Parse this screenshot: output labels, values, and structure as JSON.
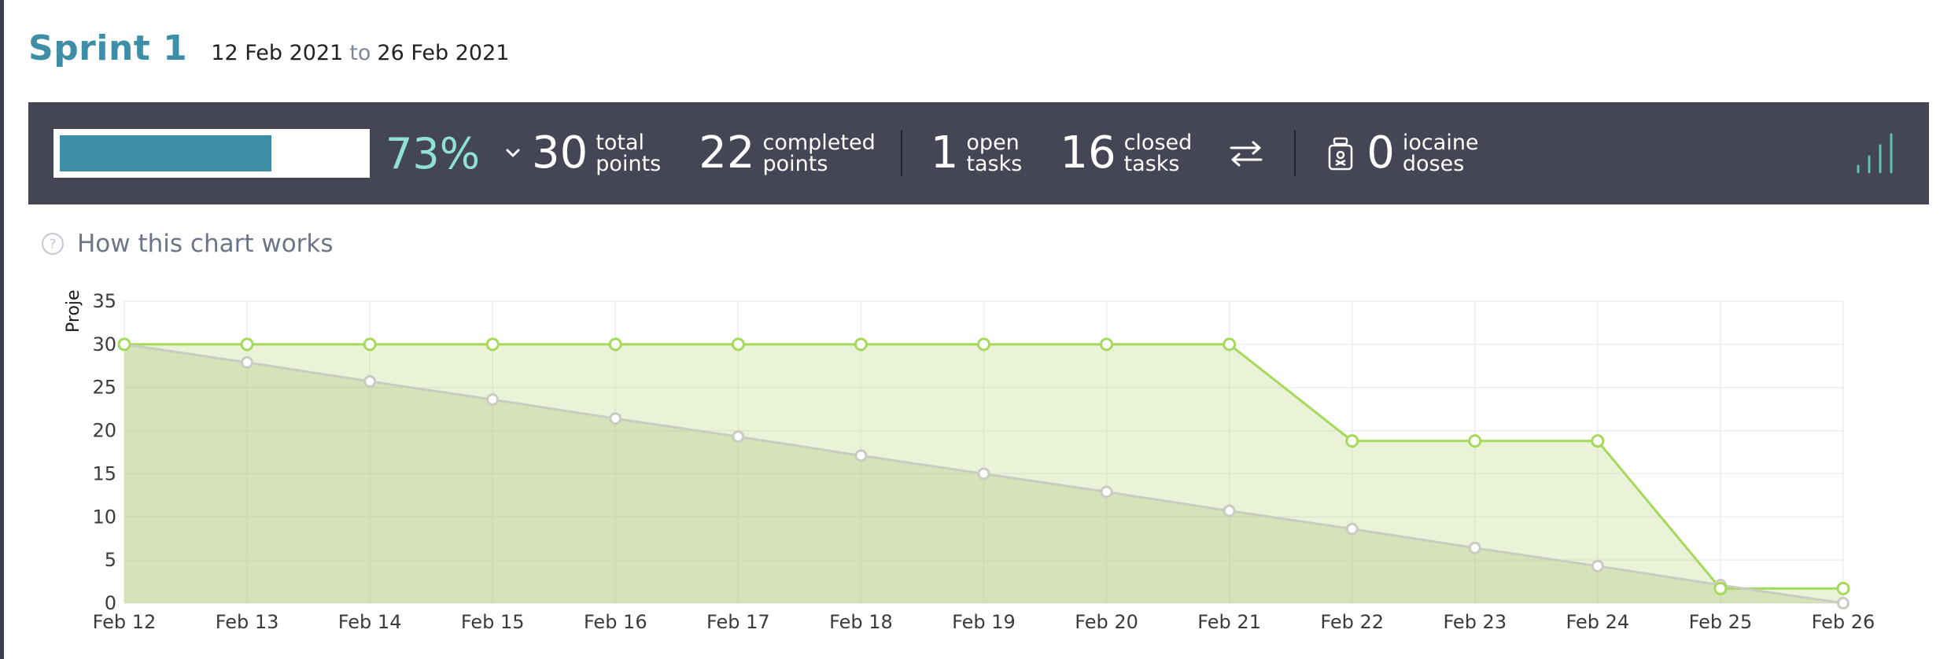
{
  "sprint": {
    "title": "Sprint 1",
    "start_date": "12 Feb 2021",
    "to": "to",
    "end_date": "26 Feb 2021"
  },
  "stats": {
    "progress_percent": 73,
    "progress_label": "73%",
    "total_points": "30",
    "total_label_1": "total",
    "total_label_2": "points",
    "completed_points": "22",
    "completed_label_1": "completed",
    "completed_label_2": "points",
    "open_tasks": "1",
    "open_label_1": "open",
    "open_label_2": "tasks",
    "closed_tasks": "16",
    "closed_label_1": "closed",
    "closed_label_2": "tasks",
    "iocaine_doses": "0",
    "iocaine_label_1": "iocaine",
    "iocaine_label_2": "doses"
  },
  "icons": {
    "expand": "chevron-down-icon",
    "swap": "swap-arrows-icon",
    "iocaine": "poison-jar-icon",
    "chart_toggle": "bar-chart-icon",
    "help": "question-circle-icon"
  },
  "help": {
    "label": "How this chart works"
  },
  "colors": {
    "accent": "#3e8ea8",
    "percent": "#8fe1d4",
    "stats_bg": "#444656",
    "real_line": "#a4d95a",
    "optimal_line": "#c9ccc2"
  },
  "chart_data": {
    "type": "line",
    "ylabel": "Proje",
    "ylim": [
      0,
      35
    ],
    "yticks": [
      0,
      5,
      10,
      15,
      20,
      25,
      30,
      35
    ],
    "categories": [
      "Feb 12",
      "Feb 13",
      "Feb 14",
      "Feb 15",
      "Feb 16",
      "Feb 17",
      "Feb 18",
      "Feb 19",
      "Feb 20",
      "Feb 21",
      "Feb 22",
      "Feb 23",
      "Feb 24",
      "Feb 25",
      "Feb 26"
    ],
    "series": [
      {
        "values": [
          30,
          30,
          30,
          30,
          30,
          30,
          30,
          30,
          30,
          30,
          18.8,
          18.8,
          18.8,
          1.7,
          1.7
        ]
      },
      {
        "values": [
          30,
          27.9,
          25.7,
          23.6,
          21.4,
          19.3,
          17.1,
          15,
          12.9,
          10.7,
          8.6,
          6.4,
          4.3,
          2.1,
          0
        ]
      }
    ],
    "grid": true
  }
}
